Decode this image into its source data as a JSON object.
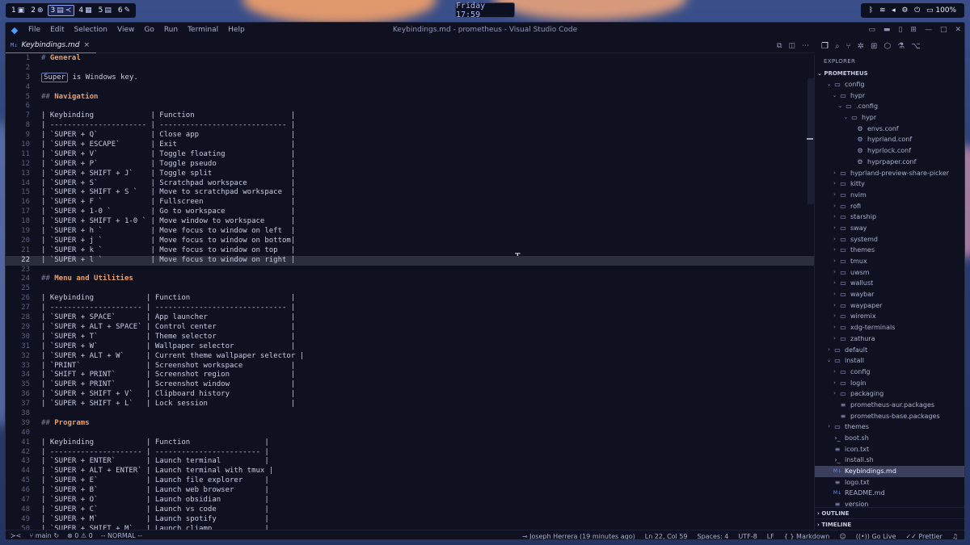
{
  "topbar": {
    "workspaces": [
      {
        "num": "1",
        "icon": "▣",
        "active": false
      },
      {
        "num": "2",
        "icon": "⊕",
        "active": false
      },
      {
        "num": "3",
        "icon": "▤",
        "active": true,
        "icon2": "≺"
      },
      {
        "num": "4",
        "icon": "▦",
        "active": false
      },
      {
        "num": "5",
        "icon": "▤",
        "active": false
      },
      {
        "num": "6",
        "icon": "✎",
        "active": false
      }
    ],
    "clock": "Friday 17:59",
    "tray": {
      "battery": "100%"
    }
  },
  "window": {
    "title": "Keybindings.md - prometheus - Visual Studio Code",
    "menu": [
      "File",
      "Edit",
      "Selection",
      "View",
      "Go",
      "Run",
      "Terminal",
      "Help"
    ]
  },
  "tab": {
    "label": "Keybindings.md",
    "close": "×",
    "type_icon": "M↓"
  },
  "editor": {
    "current_line": 22,
    "lines": [
      "# General",
      "",
      "`Super` is Windows key.",
      "",
      "## Navigation",
      "",
      "| Keybinding             | Function                      |",
      "| ---------------------- | ----------------------------- |",
      "| `SUPER + Q`            | Close app                     |",
      "| `SUPER + ESCAPE`       | Exit                          |",
      "| `SUPER + V`            | Toggle floating               |",
      "| `SUPER + P`            | Toggle pseudo                 |",
      "| `SUPER + SHIFT + J`    | Toggle split                  |",
      "| `SUPER + S`            | Scratchpad workspace          |",
      "| `SUPER + SHIFT + S `   | Move to scratchpad workspace  |",
      "| `SUPER + F `           | Fullscreen                    |",
      "| `SUPER + 1-0 `         | Go to workspace               |",
      "| `SUPER + SHIFT + 1-0 ` | Move window to workspace      |",
      "| `SUPER + h `           | Move focus to window on left  |",
      "| `SUPER + j `           | Move focus to window on bottom|",
      "| `SUPER + k `           | Move focus to window on top   |",
      "| `SUPER + l `           | Move focus to window on right |",
      "",
      "## Menu and Utilities",
      "",
      "| Keybinding            | Function                       |",
      "| --------------------- | ------------------------------ |",
      "| `SUPER + SPACE`       | App launcher                   |",
      "| `SUPER + ALT + SPACE` | Control center                 |",
      "| `SUPER + T`           | Theme selector                 |",
      "| `SUPER + W`           | Wallpaper selector             |",
      "| `SUPER + ALT + W`     | Current theme wallpaper selector |",
      "| `PRINT`               | Screenshot workspace           |",
      "| `SHIFT + PRINT`       | Screenshot region              |",
      "| `SUPER + PRINT`       | Screenshot window              |",
      "| `SUPER + SHIFT + V`   | Clipboard history              |",
      "| `SUPER + SHIFT + L`   | Lock session                   |",
      "",
      "## Programs",
      "",
      "| Keybinding            | Function                 |",
      "| --------------------- | ------------------------ |",
      "| `SUPER + ENTER`       | Launch terminal          |",
      "| `SUPER + ALT + ENTER` | Launch terminal with tmux |",
      "| `SUPER + E`           | Launch file explorer     |",
      "| `SUPER + B`           | Launch web browser       |",
      "| `SUPER + O`           | Launch obsidian          |",
      "| `SUPER + C`           | Launch vs code           |",
      "| `SUPER + M`           | Launch spotify           |",
      "| `SUPER + SHIFT + M`   | Launch cliamp            |"
    ]
  },
  "explorer": {
    "title": "EXPLORER",
    "root": "PROMETHEUS",
    "items": [
      {
        "label": "config",
        "depth": 1,
        "kind": "folder-open"
      },
      {
        "label": "hypr",
        "depth": 2,
        "kind": "folder-open"
      },
      {
        "label": ".config",
        "depth": 3,
        "kind": "folder-open"
      },
      {
        "label": "hypr",
        "depth": 4,
        "kind": "folder-open"
      },
      {
        "label": "envs.conf",
        "depth": 5,
        "kind": "gear"
      },
      {
        "label": "hypriand.conf",
        "depth": 5,
        "kind": "gear"
      },
      {
        "label": "hyprlock.conf",
        "depth": 5,
        "kind": "gear"
      },
      {
        "label": "hyprpaper.conf",
        "depth": 5,
        "kind": "gear"
      },
      {
        "label": "hyprland-preview-share-picker",
        "depth": 2,
        "kind": "folder"
      },
      {
        "label": "kitty",
        "depth": 2,
        "kind": "folder"
      },
      {
        "label": "nvim",
        "depth": 2,
        "kind": "folder"
      },
      {
        "label": "rofi",
        "depth": 2,
        "kind": "folder"
      },
      {
        "label": "starship",
        "depth": 2,
        "kind": "folder"
      },
      {
        "label": "sway",
        "depth": 2,
        "kind": "folder"
      },
      {
        "label": "systemd",
        "depth": 2,
        "kind": "folder"
      },
      {
        "label": "themes",
        "depth": 2,
        "kind": "folder"
      },
      {
        "label": "tmux",
        "depth": 2,
        "kind": "folder"
      },
      {
        "label": "uwsm",
        "depth": 2,
        "kind": "folder"
      },
      {
        "label": "wallust",
        "depth": 2,
        "kind": "folder"
      },
      {
        "label": "waybar",
        "depth": 2,
        "kind": "folder"
      },
      {
        "label": "waypaper",
        "depth": 2,
        "kind": "folder"
      },
      {
        "label": "wiremix",
        "depth": 2,
        "kind": "folder"
      },
      {
        "label": "xdg-terminals",
        "depth": 2,
        "kind": "folder"
      },
      {
        "label": "zathura",
        "depth": 2,
        "kind": "folder"
      },
      {
        "label": "default",
        "depth": 1,
        "kind": "folder"
      },
      {
        "label": "install",
        "depth": 1,
        "kind": "folder-open"
      },
      {
        "label": "config",
        "depth": 2,
        "kind": "folder"
      },
      {
        "label": "login",
        "depth": 2,
        "kind": "folder"
      },
      {
        "label": "packaging",
        "depth": 2,
        "kind": "folder"
      },
      {
        "label": "prometheus-aur.packages",
        "depth": 2,
        "kind": "file"
      },
      {
        "label": "prometheus-base.packages",
        "depth": 2,
        "kind": "file"
      },
      {
        "label": "themes",
        "depth": 1,
        "kind": "folder"
      },
      {
        "label": "boot.sh",
        "depth": 1,
        "kind": "shell"
      },
      {
        "label": "icon.txt",
        "depth": 1,
        "kind": "text"
      },
      {
        "label": "install.sh",
        "depth": 1,
        "kind": "shell"
      },
      {
        "label": "Keybindings.md",
        "depth": 1,
        "kind": "markdown",
        "selected": true
      },
      {
        "label": "logo.txt",
        "depth": 1,
        "kind": "text"
      },
      {
        "label": "README.md",
        "depth": 1,
        "kind": "markdown"
      },
      {
        "label": "version",
        "depth": 1,
        "kind": "text"
      }
    ],
    "outline": "OUTLINE",
    "timeline": "TIMELINE"
  },
  "statusbar": {
    "branch": "main",
    "problems": "0",
    "warnings": "0",
    "mode": "-- NORMAL --",
    "blame": "Joseph Herrera (19 minutes ago)",
    "position": "Ln 22, Col 59",
    "spaces": "Spaces: 4",
    "encoding": "UTF-8",
    "eol": "LF",
    "language": "Markdown",
    "golive": "Go Live",
    "prettier": "Prettier"
  }
}
